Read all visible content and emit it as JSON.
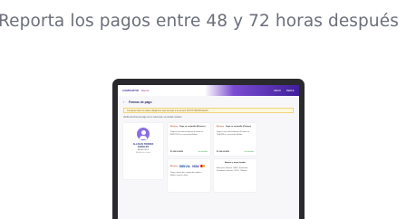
{
  "headline": "Reporta los pagos entre 48 y 72 horas después",
  "app": {
    "brand_logo": "COMPARTIR",
    "brand_secondary": "Efecto",
    "nav_links": [
      "INICIO",
      "PERFIL"
    ]
  },
  "page": {
    "title": "Formas de pago",
    "warning": "Completa todos los datos obligatorios para acceder a la sección DATOS PERSONALES",
    "verify_text": "Verifica la forma de pago con tu referencia, no pierdas contacto."
  },
  "profile": {
    "name": "ALLISAN TORRES ANGELES",
    "id": "A9KA57BC9",
    "subtitle": "Beneficiario activo"
  },
  "cards": [
    {
      "tag": "Efectivo",
      "title": "Pago en ventanilla (Efectivo)",
      "description": "Paga en una sola exhibición el monto en EFECTIVO en sucursales Elektra.",
      "price": "$1,000.00 MXN",
      "action": "Ver detalles"
    },
    {
      "tag": "Efectivo",
      "title": "Pago en ventanilla (Cheque)",
      "description": "Paga en una sola exhibición el monto en CHEQUE en sucursales Elektra.",
      "price": "$1,000.00 MXN",
      "action": "Ver detalles"
    },
    {
      "tag": "Efectivo",
      "bank_logo": "BBVA",
      "card_brand": "VISA",
      "description": "Paga a través de tu tarjeta de crédito o débito, cargo en línea."
    },
    {
      "title": "Bancos y otros tiendas",
      "description": "Bancomer, Banorte, HSBC, Santander, Scotiabank, Inbursa, OXXO, 7-Eleven."
    }
  ],
  "colors": {
    "accent_purple": "#4b2aa8",
    "warning_bg": "#fff7dc",
    "action_green": "#2e9e3e",
    "brand_red": "#d0442b"
  }
}
